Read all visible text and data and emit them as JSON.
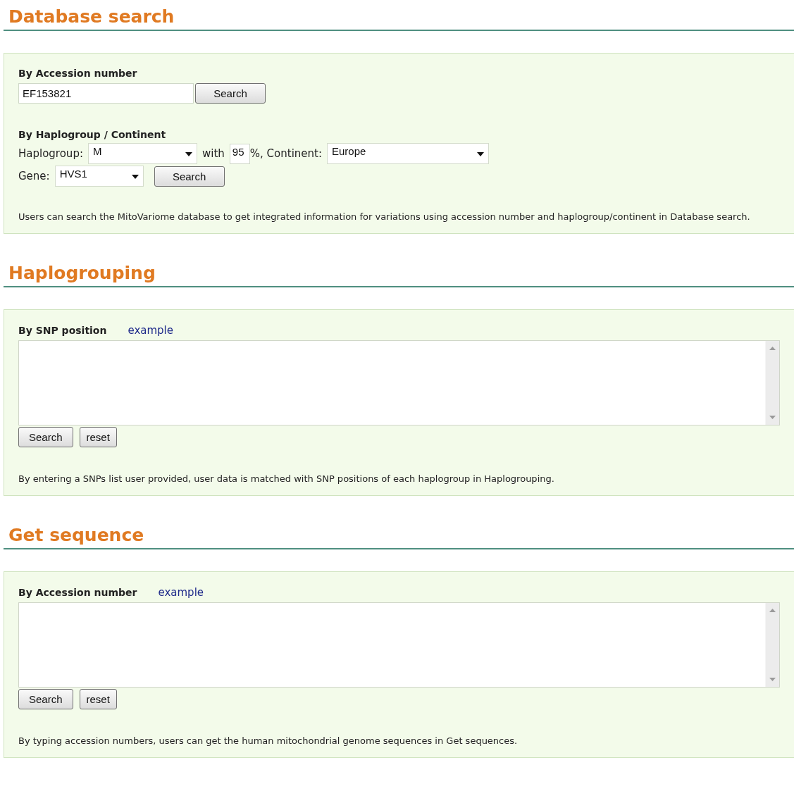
{
  "sections": [
    {
      "title": "Database search",
      "kind": "database",
      "accession": {
        "label": "By Accession number",
        "value": "EF153821",
        "button": "Search"
      },
      "haplogroup": {
        "label": "By Haplogroup / Continent",
        "haplogroup_label": "Haplogroup:",
        "haplogroup_value": "M",
        "with_label": "with",
        "percent_value": "95",
        "continent_label": "%, Continent:",
        "continent_value": "Europe",
        "gene_label": "Gene:",
        "gene_value": "HVS1",
        "button": "Search"
      },
      "description": "Users can search the MitoVariome database to get integrated information for variations using accession number and haplogroup/continent in Database search."
    },
    {
      "title": "Haplogrouping",
      "kind": "textarea",
      "label": "By SNP position",
      "link": "example",
      "buttons": [
        "Search",
        "reset"
      ],
      "description": "By entering a SNPs list user provided, user data is matched with SNP positions of each haplogroup in Haplogrouping."
    },
    {
      "title": "Get sequence",
      "kind": "textarea",
      "label": "By Accession number",
      "link": "example",
      "buttons": [
        "Search",
        "reset"
      ],
      "description": "By typing accession numbers, users can get the human mitochondrial genome sequences in Get sequences."
    }
  ]
}
